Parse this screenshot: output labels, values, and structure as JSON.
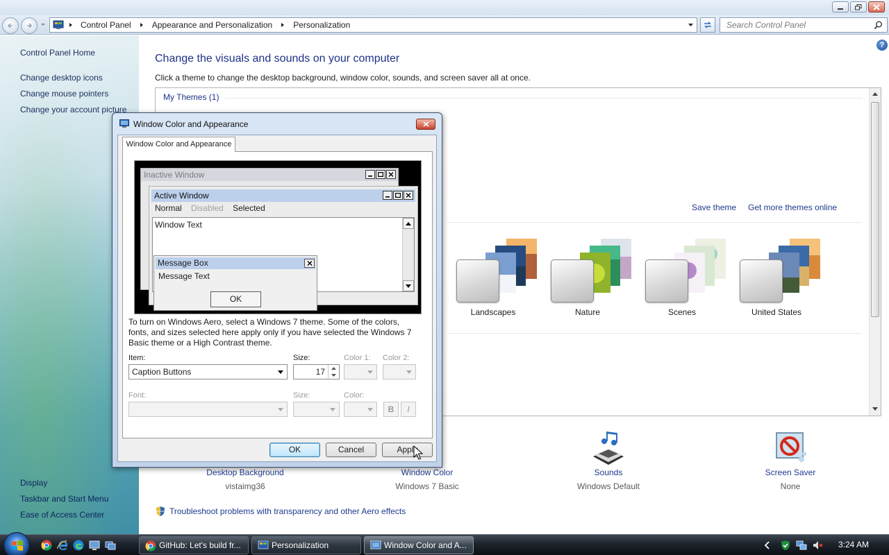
{
  "address_bar": {
    "crumbs": [
      "Control Panel",
      "Appearance and Personalization",
      "Personalization"
    ],
    "search_placeholder": "Search Control Panel"
  },
  "left_pane": {
    "links": [
      "Control Panel Home",
      "Change desktop icons",
      "Change mouse pointers",
      "Change your account picture"
    ],
    "see_also_links": [
      "Display",
      "Taskbar and Start Menu",
      "Ease of Access Center"
    ]
  },
  "main": {
    "heading": "Change the visuals and sounds on your computer",
    "description": "Click a theme to change the desktop background, window color, sounds, and screen saver all at once.",
    "my_themes": "My Themes (1)",
    "save_theme": "Save theme",
    "get_more_themes": "Get more themes online",
    "themes": [
      "Landscapes",
      "Nature",
      "Scenes",
      "United States"
    ],
    "bottom_items": [
      {
        "title": "Desktop Background",
        "value": "vistaimg36"
      },
      {
        "title": "Window Color",
        "value": "Windows 7 Basic"
      },
      {
        "title": "Sounds",
        "value": "Windows Default"
      },
      {
        "title": "Screen Saver",
        "value": "None"
      }
    ],
    "troubleshoot": "Troubleshoot problems with transparency and other Aero effects"
  },
  "dialog": {
    "title": "Window Color and Appearance",
    "tab": "Window Color and Appearance",
    "preview": {
      "inactive_window": "Inactive Window",
      "active_window": "Active Window",
      "menu": [
        "Normal",
        "Disabled",
        "Selected"
      ],
      "window_text": "Window Text",
      "message_box_title": "Message Box",
      "message_text": "Message Text",
      "ok": "OK"
    },
    "info": "To turn on Windows Aero, select a Windows 7 theme.  Some of the colors, fonts, and sizes selected here apply only if you have selected the Windows 7 Basic theme or a High Contrast theme.",
    "labels": {
      "item": "Item:",
      "size": "Size:",
      "color1": "Color 1:",
      "color2": "Color 2:",
      "font": "Font:",
      "font_size": "Size:",
      "color": "Color:",
      "bold": "B",
      "italic": "I"
    },
    "item_value": "Caption Buttons",
    "size_value": "17",
    "buttons": {
      "ok": "OK",
      "cancel": "Cancel",
      "apply": "Apply"
    }
  },
  "taskbar": {
    "buttons": [
      "GitHub: Let's build fr...",
      "Personalization",
      "Window Color and A..."
    ],
    "clock": "3:24 AM"
  },
  "colors": {
    "link": "#1e3a8c",
    "heading": "#1e3287",
    "taskbar": "#1d232b"
  }
}
